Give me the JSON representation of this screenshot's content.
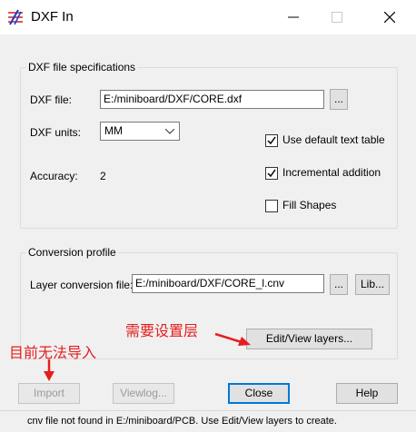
{
  "window": {
    "title": "DXF In"
  },
  "specs": {
    "group_label": "DXF file specifications",
    "file_label": "DXF file:",
    "file_value": "E:/miniboard/DXF/CORE.dxf",
    "browse_label": "...",
    "units_label": "DXF units:",
    "units_value": "MM",
    "accuracy_label": "Accuracy:",
    "accuracy_value": "2",
    "use_default_text_table": {
      "label": "Use default text table",
      "checked": true
    },
    "incremental_addition": {
      "label": "Incremental addition",
      "checked": true
    },
    "fill_shapes": {
      "label": "Fill Shapes",
      "checked": false
    }
  },
  "conversion": {
    "group_label": "Conversion profile",
    "layer_file_label": "Layer conversion file:",
    "layer_file_value": "E:/miniboard/DXF/CORE_l.cnv",
    "browse_label": "...",
    "lib_label": "Lib...",
    "edit_view_label": "Edit/View layers..."
  },
  "buttons": {
    "import": "Import",
    "viewlog": "Viewlog...",
    "close": "Close",
    "help": "Help"
  },
  "status": {
    "text": "cnv file not found in E:/miniboard/PCB. Use Edit/View layers to create."
  },
  "annotations": {
    "layer_note": "需要设置层",
    "import_note": "目前无法导入",
    "color": "#e41e1e"
  }
}
